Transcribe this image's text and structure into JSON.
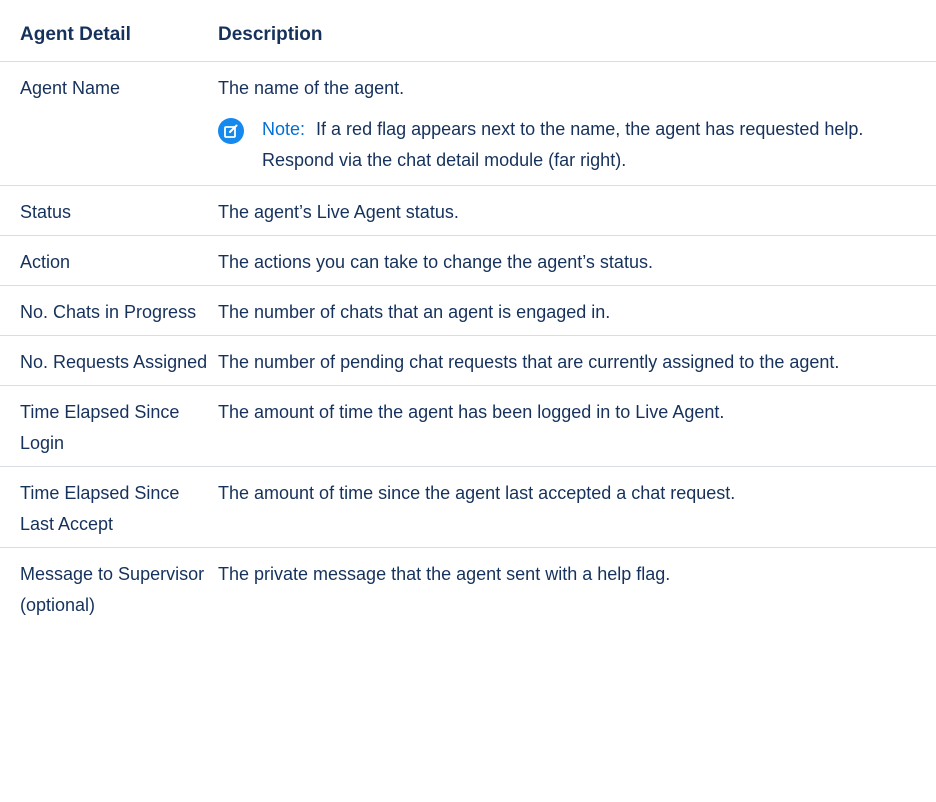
{
  "table": {
    "headers": {
      "detail": "Agent Detail",
      "description": "Description"
    },
    "rows": [
      {
        "detail": "Agent Name",
        "description": "The name of the agent.",
        "note": {
          "label": "Note:",
          "text": "If a red flag appears next to the name, the agent has requested help. Respond via the chat detail module (far right)."
        }
      },
      {
        "detail": "Status",
        "description": "The agent’s Live Agent status."
      },
      {
        "detail": "Action",
        "description": "The actions you can take to change the agent’s status."
      },
      {
        "detail": "No. Chats in Progress",
        "description": "The number of chats that an agent is engaged in."
      },
      {
        "detail": "No. Requests Assigned",
        "description": "The number of pending chat requests that are currently assigned to the agent."
      },
      {
        "detail": "Time Elapsed Since Login",
        "description": "The amount of time the agent has been logged in to Live Agent."
      },
      {
        "detail": "Time Elapsed Since Last Accept",
        "description": "The amount of time since the agent last accepted a chat request."
      },
      {
        "detail": "Message to Supervisor (optional)",
        "description": "The private message that the agent sent with a help flag."
      }
    ]
  },
  "colors": {
    "text": "#16325c",
    "note_label": "#0070d2",
    "note_icon": "#1589ee",
    "divider": "#d8dde6"
  },
  "icons": {
    "note": "note-edit-icon"
  }
}
